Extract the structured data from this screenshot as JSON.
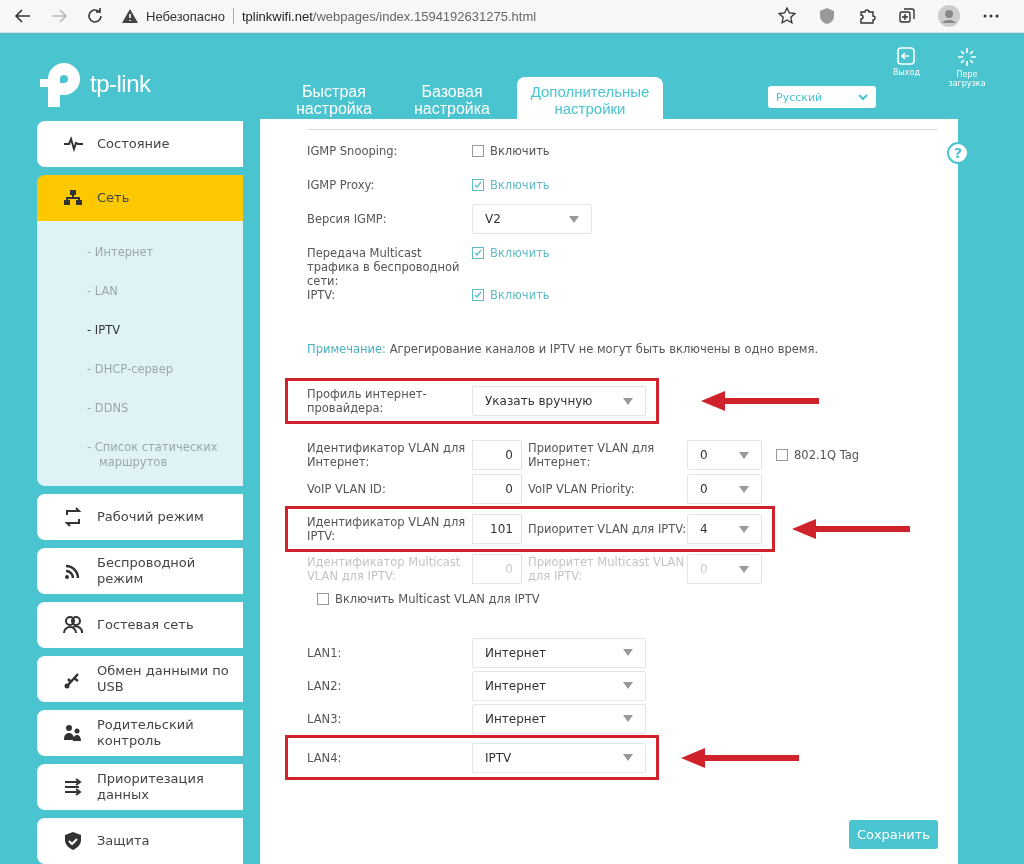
{
  "browser": {
    "security": "Небезопасно",
    "url_domain": "tplinkwifi.net",
    "url_path": "/webpages/index.1594192631275.html"
  },
  "header": {
    "logo": "tp-link",
    "tabs": [
      {
        "label": "Быстрая настройка",
        "selected": false
      },
      {
        "label": "Базовая настройка",
        "selected": false
      },
      {
        "label": "Дополнительные настройки",
        "selected": true
      }
    ],
    "language": "Русский",
    "logout": "Выход",
    "reboot": "Пере загрузка"
  },
  "sidebar": {
    "items": [
      {
        "label": "Состояние",
        "kind": "status",
        "selected": false
      },
      {
        "label": "Сеть",
        "kind": "network",
        "selected": true,
        "children": [
          {
            "label": "- Интернет",
            "selected": false
          },
          {
            "label": "- LAN",
            "selected": false
          },
          {
            "label": "- IPTV",
            "selected": true
          },
          {
            "label": "- DHCP-сервер",
            "selected": false
          },
          {
            "label": "- DDNS",
            "selected": false
          },
          {
            "label": "- Список статических маршрутов",
            "selected": false
          }
        ]
      },
      {
        "label": "Рабочий режим",
        "kind": "mode",
        "selected": false
      },
      {
        "label": "Беспроводной режим",
        "kind": "wireless",
        "selected": false
      },
      {
        "label": "Гостевая сеть",
        "kind": "guest",
        "selected": false
      },
      {
        "label": "Обмен данными по USB",
        "kind": "usb",
        "selected": false
      },
      {
        "label": "Родительский контроль",
        "kind": "parental",
        "selected": false
      },
      {
        "label": "Приоритезация данных",
        "kind": "qos",
        "selected": false
      },
      {
        "label": "Защита",
        "kind": "security",
        "selected": false
      }
    ]
  },
  "content": {
    "help": "?",
    "settings": [
      {
        "kind": "checkbox",
        "label": "IGMP Snooping:",
        "text": "Включить",
        "checked": false
      },
      {
        "kind": "checkbox",
        "label": "IGMP Proxy:",
        "text": "Включить",
        "checked": true
      },
      {
        "kind": "select",
        "label": "Версия IGMP:",
        "value": "V2"
      },
      {
        "kind": "checkbox",
        "label": "Передача Multicast трафика в беспроводной сети:",
        "text": "Включить",
        "checked": true
      },
      {
        "kind": "checkbox",
        "label": "IPTV:",
        "text": "Включить",
        "checked": true
      }
    ],
    "note": {
      "title": "Примечание:",
      "text": "Агрегирование каналов и IPTV не могут быть включены в одно время."
    },
    "isp_profile": {
      "label": "Профиль интернет-провайдера:",
      "value": "Указать вручную",
      "highlighted": true
    },
    "vlan_rows": [
      {
        "label": "Идентификатор VLAN для Интернет:",
        "value": "0",
        "priority_label": "Приоритет VLAN для Интернет:",
        "priority": "0",
        "disabled": false,
        "highlighted": false,
        "tag": {
          "label": "802.1Q Tag",
          "checked": false
        }
      },
      {
        "label": "VoIP VLAN ID:",
        "value": "0",
        "priority_label": "VoIP VLAN Priority:",
        "priority": "0",
        "disabled": false,
        "highlighted": false
      },
      {
        "label": "Идентификатор VLAN для IPTV:",
        "value": "101",
        "priority_label": "Приоритет VLAN для IPTV:",
        "priority": "4",
        "disabled": false,
        "highlighted": true
      },
      {
        "label": "Идентификатор Multicast VLAN для IPTV:",
        "value": "0",
        "priority_label": "Приоритет Multicast VLAN для IPTV:",
        "priority": "0",
        "disabled": true,
        "highlighted": false
      }
    ],
    "multicast_vlan": {
      "text": "Включить Multicast VLAN для IPTV",
      "checked": false
    },
    "lan_ports": [
      {
        "label": "LAN1:",
        "value": "Интернет",
        "highlighted": false
      },
      {
        "label": "LAN2:",
        "value": "Интернет",
        "highlighted": false
      },
      {
        "label": "LAN3:",
        "value": "Интернет",
        "highlighted": false
      },
      {
        "label": "LAN4:",
        "value": "IPTV",
        "highlighted": true
      }
    ],
    "save": "Сохранить"
  }
}
